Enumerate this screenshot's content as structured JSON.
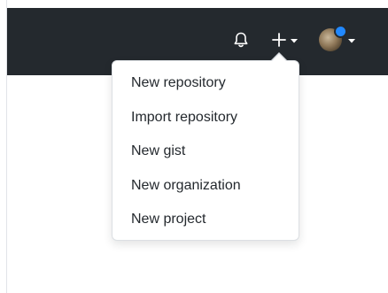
{
  "header": {
    "icons": {
      "notifications": "bell-icon",
      "create": "plus-icon",
      "create_caret": "caret-down-icon",
      "avatar_caret": "caret-down-icon"
    },
    "colors": {
      "header_bg": "#24292e",
      "icon": "#ffffff",
      "notification_dot": "#2188ff"
    }
  },
  "create_menu": {
    "items": [
      {
        "label": "New repository"
      },
      {
        "label": "Import repository"
      },
      {
        "label": "New gist"
      },
      {
        "label": "New organization"
      },
      {
        "label": "New project"
      }
    ]
  }
}
